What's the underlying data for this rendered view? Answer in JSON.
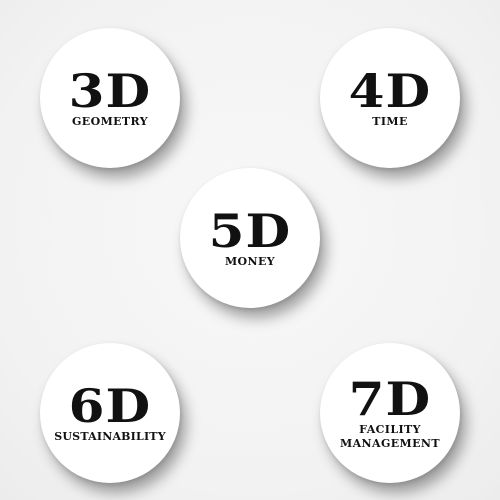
{
  "circles": [
    {
      "id": "3d",
      "big": "3D",
      "label_lines": [
        "GEOMETRY"
      ]
    },
    {
      "id": "4d",
      "big": "4D",
      "label_lines": [
        "TIME"
      ]
    },
    {
      "id": "5d",
      "big": "5D",
      "label_lines": [
        "MONEY"
      ]
    },
    {
      "id": "6d",
      "big": "6D",
      "label_lines": [
        "SUSTAINABILITY"
      ]
    },
    {
      "id": "7d",
      "big": "7D",
      "label_lines": [
        "FACILITY",
        "MANAGEMENT"
      ]
    }
  ]
}
